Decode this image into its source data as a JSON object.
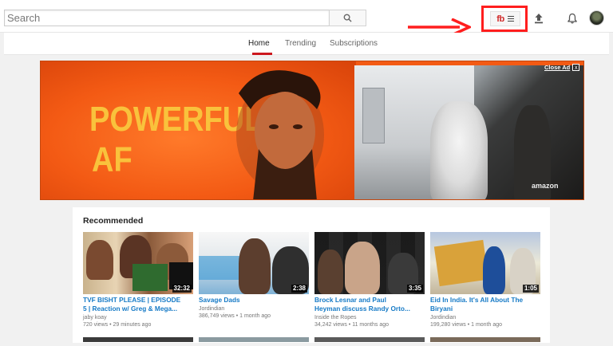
{
  "search": {
    "placeholder": "Search"
  },
  "extension": {
    "label": "fb"
  },
  "nav": {
    "tabs": [
      {
        "label": "Home"
      },
      {
        "label": "Trending"
      },
      {
        "label": "Subscriptions"
      }
    ]
  },
  "ad": {
    "headline_line1": "POWERFUL",
    "headline_line2": "AF",
    "close_label": "Close Ad",
    "close_x": "x",
    "brand": "amazon"
  },
  "recommended": {
    "title": "Recommended",
    "videos": [
      {
        "title_line1": "TVF BISHT PLEASE | EPISODE",
        "title_line2": "5 | Reaction w/ Greg & Mega...",
        "channel": "jaby koay",
        "views": "720 views",
        "age": "29 minutes ago",
        "duration": "32:32"
      },
      {
        "title_line1": "Savage Dads",
        "title_line2": "",
        "channel": "Jordindian",
        "views": "386,749 views",
        "age": "1 month ago",
        "duration": "2:38"
      },
      {
        "title_line1": "Brock Lesnar and Paul",
        "title_line2": "Heyman discuss Randy Orto...",
        "channel": "Inside the Ropes",
        "views": "34,242 views",
        "age": "11 months ago",
        "duration": "3:35"
      },
      {
        "title_line1": "Eid In India. It's All About The",
        "title_line2": "Biryani",
        "channel": "Jordindian",
        "views": "199,280 views",
        "age": "1 month ago",
        "duration": "1:05"
      }
    ]
  },
  "colors": {
    "accent": "#cc181e",
    "link": "#167ac6",
    "annotation": "#ff1e1e",
    "ad_bg": "#f35a14",
    "ad_text": "#f9c23c"
  }
}
